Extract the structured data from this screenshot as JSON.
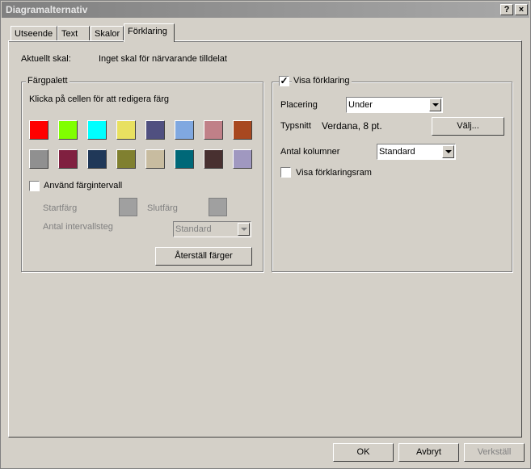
{
  "window": {
    "title": "Diagramalternativ",
    "help_btn": "?",
    "close_btn": "×"
  },
  "tabs": [
    {
      "label": "Utseende"
    },
    {
      "label": "Text"
    },
    {
      "label": "Skalor"
    },
    {
      "label": "Förklaring",
      "active": true
    }
  ],
  "current_scale": {
    "label": "Aktuellt skal:",
    "value": "Inget skal för närvarande tilldelat"
  },
  "palette": {
    "title": "Färgpalett",
    "instruction": "Klicka på cellen för att redigera färg",
    "colors_row1": [
      "#ff0000",
      "#80ff00",
      "#00ffff",
      "#e8e060",
      "#505080",
      "#80a8e0",
      "#c08088",
      "#a84820"
    ],
    "colors_row2": [
      "#909090",
      "#802040",
      "#203858",
      "#808030",
      "#c8bca0",
      "#006878",
      "#483030",
      "#a098c0"
    ],
    "use_interval_label": "Använd färgintervall",
    "start_label": "Startfärg",
    "end_label": "Slutfärg",
    "steps_label": "Antal intervallsteg",
    "steps_value": "Standard",
    "reset_button": "Återställ färger"
  },
  "legend": {
    "show_label": "Visa förklaring",
    "show_checked": true,
    "placement_label": "Placering",
    "placement_value": "Under",
    "font_label": "Typsnitt",
    "font_value": "Verdana, 8 pt.",
    "choose_button": "Välj...",
    "columns_label": "Antal kolumner",
    "columns_value": "Standard",
    "frame_label": "Visa förklaringsram",
    "frame_checked": false
  },
  "footer": {
    "ok": "OK",
    "cancel": "Avbryt",
    "apply": "Verkställ"
  }
}
